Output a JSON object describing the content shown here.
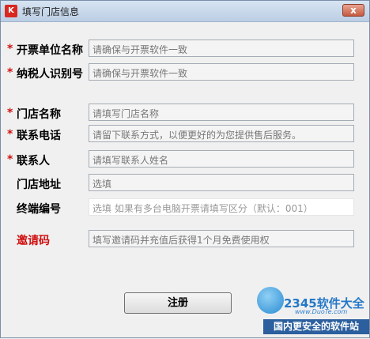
{
  "window": {
    "title": "填写门店信息",
    "app_icon_text": "K",
    "close_symbol": "x"
  },
  "form": {
    "rows": [
      {
        "required": true,
        "label": "开票单位名称",
        "placeholder": "请确保与开票软件一致"
      },
      {
        "required": true,
        "label": "纳税人识别号",
        "placeholder": "请确保与开票软件一致"
      },
      {
        "required": true,
        "label": "门店名称",
        "placeholder": "请填写门店名称"
      },
      {
        "required": true,
        "label": "联系电话",
        "placeholder": "请留下联系方式，以便更好的为您提供售后服务。"
      },
      {
        "required": true,
        "label": "联系人",
        "placeholder": "请填写联系人姓名"
      },
      {
        "required": false,
        "label": "门店地址",
        "placeholder": "选填"
      },
      {
        "required": false,
        "label": "终端编号",
        "placeholder": "选填  如果有多台电脑开票请填写区分（默认：001）"
      },
      {
        "required": false,
        "label": "邀请码",
        "placeholder": "填写邀请码并充值后获得1个月免费使用权"
      }
    ],
    "required_mark": "*"
  },
  "buttons": {
    "register": "注册"
  },
  "watermark": {
    "brand": "2345软件大全",
    "url": "www.DuoTe.com",
    "slogan": "国内更安全的软件站"
  },
  "colors": {
    "required_mark": "#d01010",
    "invite_label": "#d01010",
    "titlebar": "#c8d8ec"
  }
}
